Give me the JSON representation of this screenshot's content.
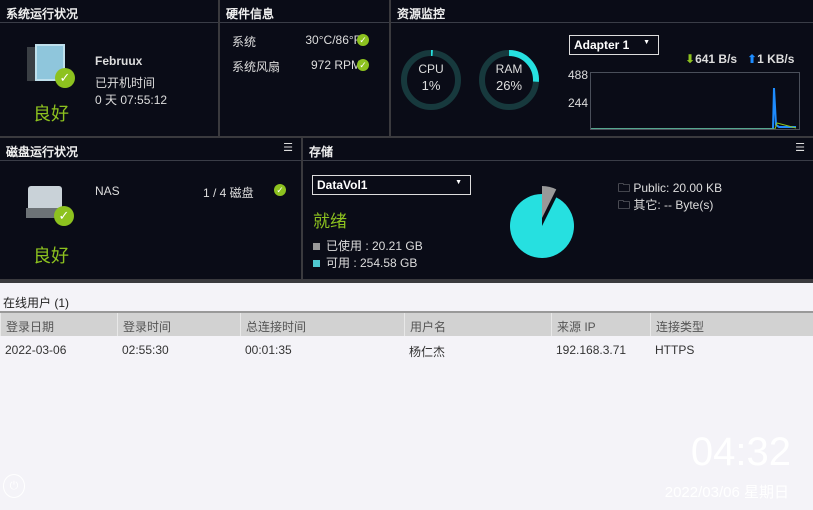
{
  "system": {
    "title": "系统运行状况",
    "name": "Februux",
    "uptime_label": "已开机时间",
    "uptime": "0 天 07:55:12",
    "status": "良好"
  },
  "hardware": {
    "title": "硬件信息",
    "rows": [
      {
        "label": "系统",
        "value": "30°C/86°F"
      },
      {
        "label": "系统风扇",
        "value": "972 RPM"
      }
    ]
  },
  "resource": {
    "title": "资源监控",
    "cpu_label": "CPU",
    "cpu": "1%",
    "cpu_percent": 1,
    "ram_label": "RAM",
    "ram": "26%",
    "ram_percent": 26,
    "adapter": "Adapter 1",
    "down": "641 B/s",
    "up": "1 KB/s",
    "y_ticks": [
      "488",
      "244"
    ]
  },
  "disk": {
    "title": "磁盘运行状况",
    "name": "NAS",
    "count": "1 / 4 磁盘",
    "status": "良好"
  },
  "storage": {
    "title": "存储",
    "volume": "DataVol1",
    "status": "就绪",
    "used": "已使用 : 20.21 GB",
    "free": "可用 : 254.58 GB",
    "used_gb": 20.21,
    "free_gb": 254.58,
    "folders": [
      "Public: 20.00 KB",
      "其它: -- Byte(s)"
    ],
    "colors": {
      "used": "#999999",
      "free": "#26e0e0"
    }
  },
  "users": {
    "title": "在线用户 (1)",
    "columns": [
      "登录日期",
      "登录时间",
      "总连接时间",
      "用户名",
      "来源 IP",
      "连接类型"
    ],
    "rows": [
      [
        "2022-03-06",
        "02:55:30",
        "00:01:35",
        "杨仁杰",
        "192.168.3.71",
        "HTTPS"
      ]
    ]
  },
  "clock": {
    "time": "04:32",
    "date": "2022/03/06 星期日"
  }
}
